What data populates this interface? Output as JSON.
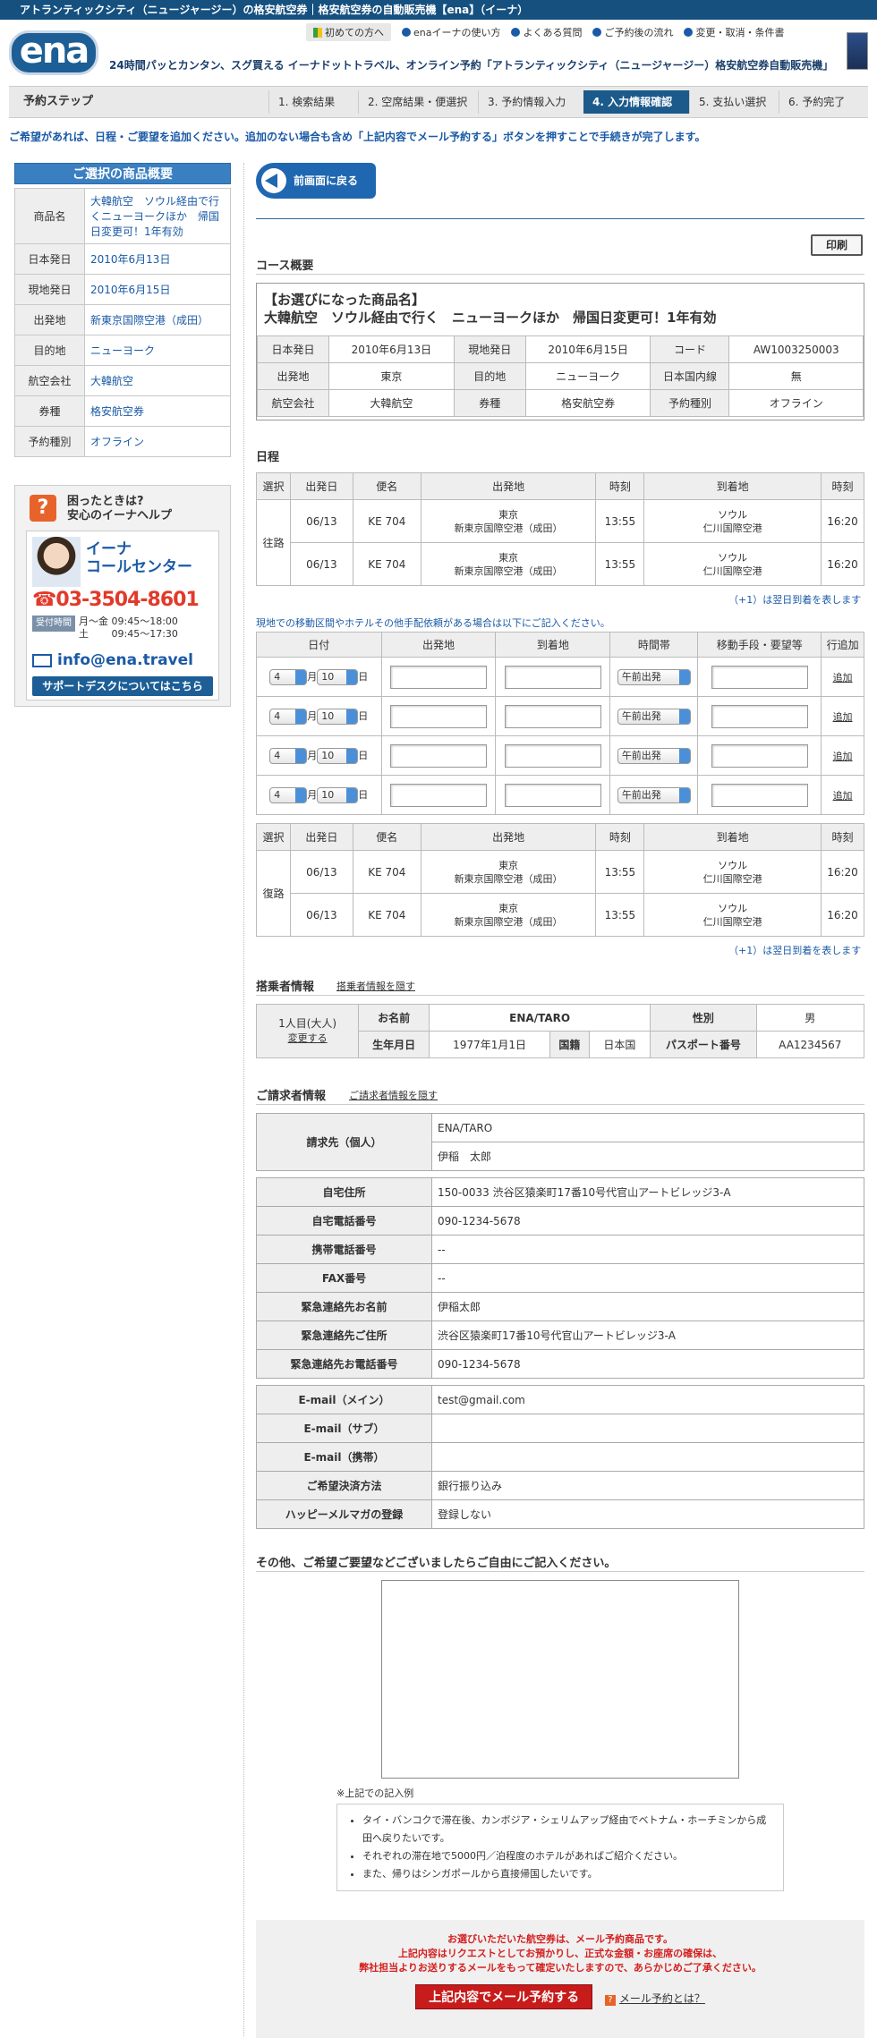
{
  "topbar": {
    "title": "アトランティックシティ（ニュージャージー）の格安航空券｜格安航空券の自動販売機【ena】（イーナ）"
  },
  "header": {
    "logo": "ena",
    "nav": [
      "初めての方へ",
      "enaイーナの使い方",
      "よくある質問",
      "ご予約後の流れ",
      "変更・取消・条件書"
    ],
    "tagline": "24時間パッとカンタン、スグ買える イーナドットトラベル、オンライン予約「アトランティックシティ（ニュージャージー）格安航空券自動販売機」"
  },
  "steps": {
    "label": "予約ステップ",
    "items": [
      "1. 検索結果",
      "2. 空席結果・便選択",
      "3. 予約情報入力",
      "4. 入力情報確認",
      "5. 支払い選択",
      "6. 予約完了"
    ],
    "active_index": 3
  },
  "notice": "ご希望があれば、日程・ご要望を追加ください。追加のない場合も含め「上記内容でメール予約する」ボタンを押すことで手続きが完了します。",
  "sidebar": {
    "title": "ご選択の商品概要",
    "rows": [
      {
        "label": "商品名",
        "value": "大韓航空　ソウル経由で行くニューヨークほか　帰国日変更可！1年有効"
      },
      {
        "label": "日本発日",
        "value": "2010年6月13日"
      },
      {
        "label": "現地発日",
        "value": "2010年6月15日"
      },
      {
        "label": "出発地",
        "value": "新東京国際空港（成田）"
      },
      {
        "label": "目的地",
        "value": "ニューヨーク"
      },
      {
        "label": "航空会社",
        "value": "大韓航空"
      },
      {
        "label": "券種",
        "value": "格安航空券"
      },
      {
        "label": "予約種別",
        "value": "オフライン"
      }
    ],
    "help": {
      "title_line1": "困ったときは?",
      "title_line2": "安心のイーナヘルプ",
      "center_line1": "イーナ",
      "center_line2": "コールセンター",
      "phone": "03-3504-8601",
      "hours_badge": "受付時間",
      "hours_line1": "月～金 09:45～18:00",
      "hours_line2": "土　　 09:45～17:30",
      "email": "info@ena.travel",
      "support": "サポートデスクについてはこちら"
    }
  },
  "main": {
    "back_button": "前画面に戻る",
    "print_button": "印刷",
    "course": {
      "title": "コース概要",
      "product_label": "【お選びになった商品名】",
      "product_name": "大韓航空　ソウル経由で行く　ニューヨークほか　帰国日変更可！1年有効",
      "rows": [
        [
          "日本発日",
          "2010年6月13日",
          "現地発日",
          "2010年6月15日",
          "コード",
          "AW1003250003"
        ],
        [
          "出発地",
          "東京",
          "目的地",
          "ニューヨーク",
          "日本国内線",
          "無"
        ],
        [
          "航空会社",
          "大韓航空",
          "券種",
          "格安航空券",
          "予約種別",
          "オフライン"
        ]
      ]
    },
    "schedule": {
      "title": "日程",
      "headers": [
        "選択",
        "出発日",
        "便名",
        "出発地",
        "時刻",
        "到着地",
        "時刻"
      ],
      "outbound_label": "往路",
      "return_label": "復路",
      "outbound": [
        {
          "date": "06/13",
          "flight": "KE 704",
          "from1": "東京",
          "from2": "新東京国際空港（成田）",
          "dep": "13:55",
          "to1": "ソウル",
          "to2": "仁川国際空港",
          "arr": "16:20"
        },
        {
          "date": "06/13",
          "flight": "KE 704",
          "from1": "東京",
          "from2": "新東京国際空港（成田）",
          "dep": "13:55",
          "to1": "ソウル",
          "to2": "仁川国際空港",
          "arr": "16:20"
        }
      ],
      "return": [
        {
          "date": "06/13",
          "flight": "KE 704",
          "from1": "東京",
          "from2": "新東京国際空港（成田）",
          "dep": "13:55",
          "to1": "ソウル",
          "to2": "仁川国際空港",
          "arr": "16:20"
        },
        {
          "date": "06/13",
          "flight": "KE 704",
          "from1": "東京",
          "from2": "新東京国際空港（成田）",
          "dep": "13:55",
          "to1": "ソウル",
          "to2": "仁川国際空港",
          "arr": "16:20"
        }
      ],
      "next_day_note": "（+1）は翌日到着を表します",
      "local_note": "現地での移動区間やホテルその他手配依頼がある場合は以下にご記入ください。",
      "local_headers": [
        "日付",
        "出発地",
        "到着地",
        "時間帯",
        "移動手段・要望等",
        "行追加"
      ],
      "local_month": "4",
      "local_day": "10",
      "month_unit": "月",
      "day_unit": "日",
      "time_option": "午前出発",
      "add_link": "追加"
    },
    "passenger": {
      "title": "搭乗者情報",
      "hide_link": "搭乗者情報を隠す",
      "person": "1人目(大人)",
      "change_link": "変更する",
      "name_label": "お名前",
      "name": "ENA/TARO",
      "gender_label": "性別",
      "gender": "男",
      "birth_label": "生年月日",
      "birth": "1977年1月1日",
      "nationality_label": "国籍",
      "nationality": "日本国",
      "passport_label": "パスポート番号",
      "passport": "AA1234567"
    },
    "billing": {
      "title": "ご請求者情報",
      "hide_link": "ご請求者情報を隠す",
      "payer_label": "請求先（個人）",
      "payer_roman": "ENA/TARO",
      "payer_kanji": "伊稲　太郎",
      "rows1": [
        {
          "label": "自宅住所",
          "value": "150-0033 渋谷区猿楽町17番10号代官山アートビレッジ3-A"
        },
        {
          "label": "自宅電話番号",
          "value": "090-1234-5678"
        },
        {
          "label": "携帯電話番号",
          "value": "--"
        },
        {
          "label": "FAX番号",
          "value": "--"
        },
        {
          "label": "緊急連絡先お名前",
          "value": "伊稲太郎"
        },
        {
          "label": "緊急連絡先ご住所",
          "value": "渋谷区猿楽町17番10号代官山アートビレッジ3-A"
        },
        {
          "label": "緊急連絡先お電話番号",
          "value": "090-1234-5678"
        }
      ],
      "rows2": [
        {
          "label": "E-mail（メイン）",
          "value": "test@gmail.com"
        },
        {
          "label": "E-mail（サブ）",
          "value": ""
        },
        {
          "label": "E-mail（携帯）",
          "value": ""
        },
        {
          "label": "ご希望決済方法",
          "value": "銀行振り込み"
        },
        {
          "label": "ハッピーメルマガの登録",
          "value": "登録しない"
        }
      ]
    },
    "request": {
      "title": "その他、ご希望ご要望などございましたらご自由にご記入ください。",
      "example_title": "※上記での記入例",
      "examples": [
        "タイ・バンコクで滞在後、カンボジア・シェリムアップ経由でベトナム・ホーチミンから成田へ戻りたいです。",
        "それぞれの滞在地で5000円／泊程度のホテルがあればご紹介ください。",
        "また、帰りはシンガポールから直接帰国したいです。"
      ]
    },
    "footer": {
      "line1": "お選びいただいた航空券は、メール予約商品です。",
      "line2": "上記内容はリクエストとしてお預かりし、正式な金額・お座席の確保は、",
      "line3": "弊社担当よりお送りするメールをもって確定いたしますので、あらかじめご了承ください。",
      "submit": "上記内容でメール予約する",
      "what_is": "メール予約とは？"
    }
  }
}
